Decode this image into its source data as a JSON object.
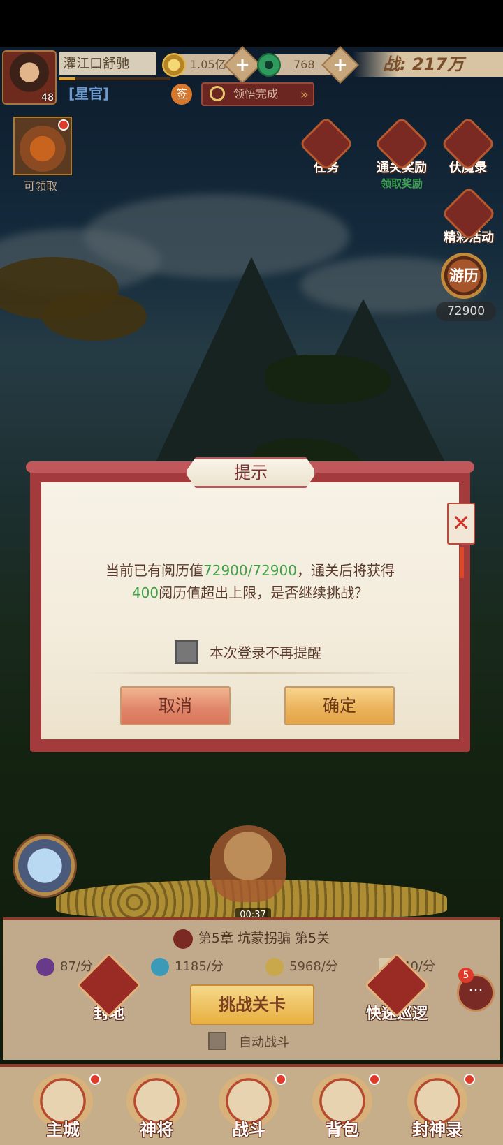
{
  "player": {
    "name": "灌江口舒驰",
    "level": "48",
    "title": "[星官]",
    "exp_fraction": 0.15
  },
  "resources": {
    "gold": "1.05亿",
    "jade": "768",
    "power": "战: 217万"
  },
  "quest": {
    "label": "领悟完成"
  },
  "talk_icon": "签",
  "claim_label": "可领取",
  "side_icons": {
    "task": "任务",
    "clear_reward": "通关奖励",
    "clear_reward_sub": "领取奖励",
    "demon_record": "伏魔录",
    "events": "精彩活动",
    "travel": "游历",
    "travel_value": "72900"
  },
  "dialog": {
    "title": "提示",
    "line1_prefix": "当前已有阅历值",
    "line1_value": "72900/72900",
    "line1_suffix": "，通关后将获得",
    "line2_value": "400",
    "line2_suffix": "阅历值超出上限，是否继续挑战？",
    "checkbox_label": "本次登录不再提醒",
    "cancel": "取消",
    "confirm": "确定",
    "close_glyph": "✕"
  },
  "battle": {
    "timer": "00:37",
    "chapter": "第5章 坑蒙拐骗 第5关",
    "rates": [
      "87/分",
      "1185/分",
      "5968/分",
      "40/分"
    ],
    "challenge": "挑战关卡",
    "auto": "自动战斗",
    "fief": "封地",
    "patrol": "快速巡逻",
    "chat_badge": "5",
    "chat_glyph": "···"
  },
  "nav": [
    "主城",
    "神将",
    "战斗",
    "背包",
    "封神录"
  ],
  "colors": {
    "dialog_frame": "#a33a3b",
    "highlight_green": "#41a047",
    "text_brown": "#5b3a2c"
  }
}
